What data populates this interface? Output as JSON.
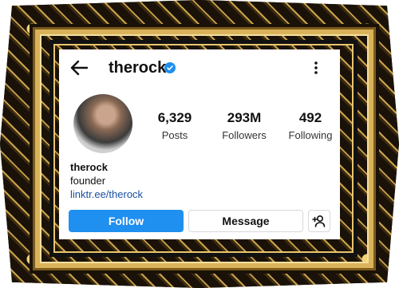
{
  "profile": {
    "username": "therock",
    "stats": {
      "posts_count": "6,329",
      "posts_label": "Posts",
      "followers_count": "293M",
      "followers_label": "Followers",
      "following_count": "492",
      "following_label": "Following"
    },
    "bio": {
      "name": "therock",
      "text": "founder",
      "link": "linktr.ee/therock"
    }
  },
  "actions": {
    "follow_label": "Follow",
    "message_label": "Message"
  },
  "icons": {
    "back": "arrow-left-icon",
    "verified": "verified-badge-icon",
    "more": "more-vertical-icon",
    "add_user": "add-user-icon"
  },
  "colors": {
    "accent": "#1f8ff0",
    "link": "#1a4fa3",
    "frame_gold": "#d9b25a",
    "frame_dark": "#1a1208"
  }
}
